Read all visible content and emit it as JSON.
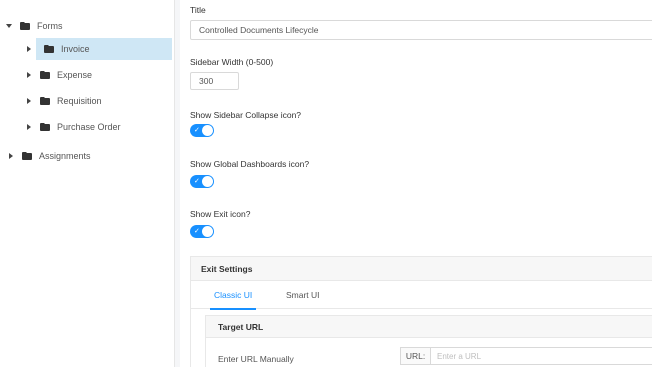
{
  "tree": {
    "items": [
      {
        "label": "Forms",
        "state": "expanded"
      },
      {
        "label": "Invoice",
        "state": "collapsed",
        "selected": true
      },
      {
        "label": "Expense",
        "state": "collapsed"
      },
      {
        "label": "Requisition",
        "state": "collapsed"
      },
      {
        "label": "Purchase Order",
        "state": "collapsed"
      },
      {
        "label": "Assignments",
        "state": "collapsed"
      }
    ]
  },
  "form": {
    "title_label": "Title",
    "title_value": "Controlled Documents Lifecycle",
    "sidebar_width_label": "Sidebar Width (0-500)",
    "sidebar_width_value": "300",
    "show_collapse_label": "Show Sidebar Collapse icon?",
    "show_collapse_on": true,
    "show_dashboards_label": "Show Global Dashboards icon?",
    "show_dashboards_on": true,
    "show_exit_label": "Show Exit icon?",
    "show_exit_on": true
  },
  "exit_settings": {
    "title": "Exit Settings",
    "tabs": [
      {
        "label": "Classic UI",
        "active": true
      },
      {
        "label": "Smart UI",
        "active": false
      }
    ],
    "target_url": {
      "title": "Target URL",
      "manual_label": "Enter URL Manually",
      "url_addon": "URL:",
      "url_placeholder": "Enter a URL"
    }
  },
  "colors": {
    "accent": "#1890ff",
    "selected_bg": "#cfe7f5",
    "folder": "#333333"
  }
}
